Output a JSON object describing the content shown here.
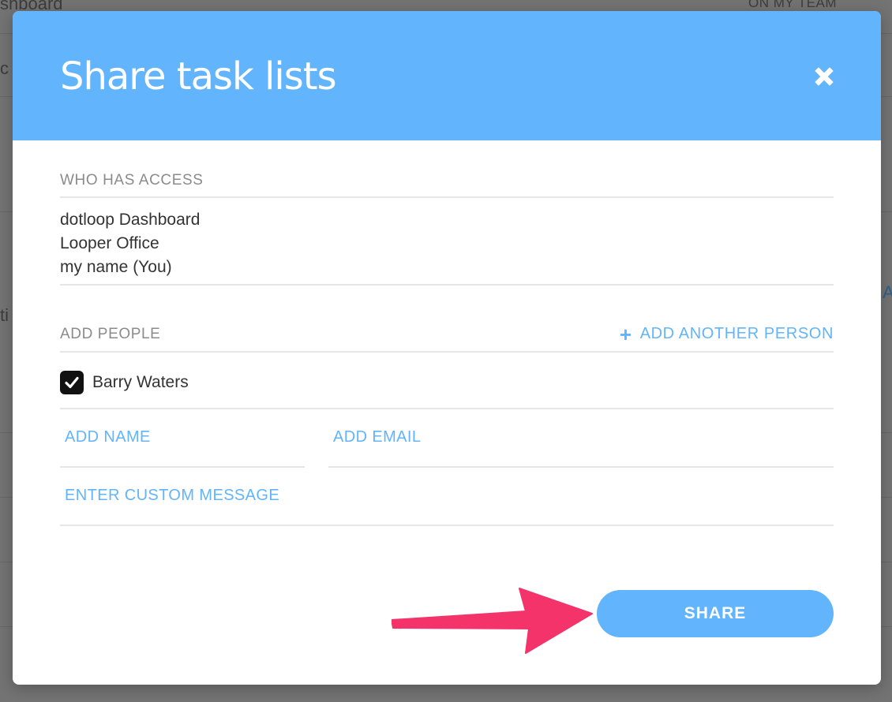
{
  "background": {
    "top_left_text": "shboard",
    "top_right_text": "ON MY TEAM",
    "left_fragment_1": "c",
    "left_fragment_2": "ti",
    "right_fragment": "A"
  },
  "modal": {
    "title": "Share task lists",
    "close_icon": "close-icon",
    "who_has_access": {
      "label": "WHO HAS ACCESS",
      "entries": [
        "dotloop Dashboard",
        "Looper Office",
        "my name (You)"
      ]
    },
    "add_people": {
      "label": "ADD PEOPLE",
      "add_another_label": "ADD ANOTHER PERSON",
      "people": [
        {
          "name": "Barry Waters",
          "checked": true
        }
      ],
      "name_placeholder": "ADD NAME",
      "email_placeholder": "ADD EMAIL",
      "message_placeholder": "ENTER CUSTOM MESSAGE"
    },
    "share_label": "SHARE"
  },
  "colors": {
    "accent": "#62b4fc",
    "annotation_arrow": "#f4336b",
    "overlay": "#737373"
  }
}
